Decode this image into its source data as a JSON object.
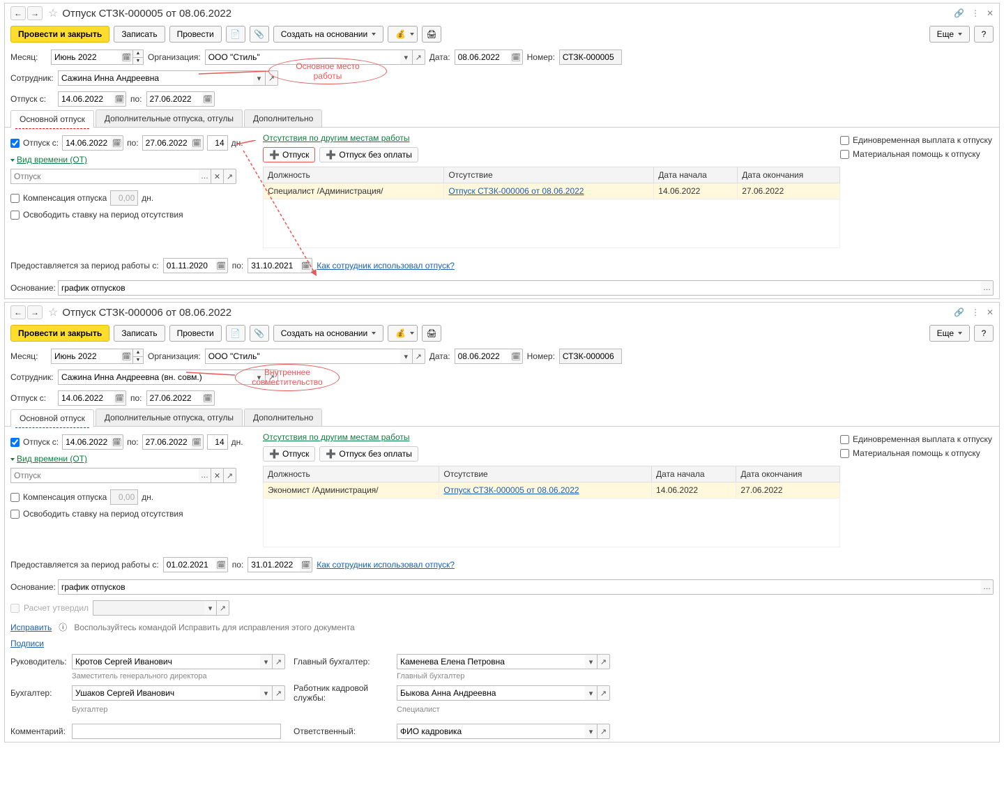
{
  "window1": {
    "title": "Отпуск СТЗК-000005 от 08.06.2022",
    "callout": "Основное место работы",
    "toolbar": {
      "post_close": "Провести и закрыть",
      "record": "Записать",
      "post": "Провести",
      "create_based": "Создать на основании",
      "more": "Еще"
    },
    "header": {
      "month_label": "Месяц:",
      "month": "Июнь 2022",
      "org_label": "Организация:",
      "org": "ООО \"Стиль\"",
      "date_label": "Дата:",
      "date": "08.06.2022",
      "num_label": "Номер:",
      "num": "СТЗК-000005",
      "employee_label": "Сотрудник:",
      "employee": "Сажина Инна Андреевна",
      "leave_from_label": "Отпуск с:",
      "leave_from": "14.06.2022",
      "leave_to_label": "по:",
      "leave_to": "27.06.2022"
    },
    "tabs": {
      "main": "Основной отпуск",
      "extra": "Дополнительные отпуска, отгулы",
      "more": "Дополнительно"
    },
    "mainTab": {
      "vac_label": "Отпуск  с:",
      "from": "14.06.2022",
      "to_label": "по:",
      "to": "27.06.2022",
      "days": "14",
      "days_unit": "дн.",
      "time_kind": "Вид времени (ОТ)",
      "time_placeholder": "Отпуск",
      "comp_label": "Компенсация отпуска",
      "comp_val": "0,00",
      "comp_unit": "дн.",
      "free_rate": "Освободить ставку на период отсутствия",
      "absences_link": "Отсутствия по другим местам работы",
      "btn_vac": "Отпуск",
      "btn_unpaid": "Отпуск без оплаты",
      "cols": {
        "pos": "Должность",
        "abs": "Отсутствие",
        "start": "Дата начала",
        "end": "Дата окончания"
      },
      "row": {
        "pos": "Специалист /Администрация/",
        "abs": "Отпуск СТЗК-000006 от 08.06.2022",
        "start": "14.06.2022",
        "end": "27.06.2022"
      },
      "lump_sum": "Единовременная выплата к отпуску",
      "mat_help": "Материальная помощь к отпуску"
    },
    "period": {
      "label": "Предоставляется за период работы с:",
      "from": "01.11.2020",
      "to_label": "по:",
      "to": "31.10.2021",
      "how_link": "Как сотрудник использовал отпуск?"
    },
    "basis": {
      "label": "Основание:",
      "value": "график отпусков"
    }
  },
  "window2": {
    "title": "Отпуск СТЗК-000006 от 08.06.2022",
    "callout": "Внутреннее совместительство",
    "toolbar": {
      "post_close": "Провести и закрыть",
      "record": "Записать",
      "post": "Провести",
      "create_based": "Создать на основании",
      "more": "Еще"
    },
    "header": {
      "month_label": "Месяц:",
      "month": "Июнь 2022",
      "org_label": "Организация:",
      "org": "ООО \"Стиль\"",
      "date_label": "Дата:",
      "date": "08.06.2022",
      "num_label": "Номер:",
      "num": "СТЗК-000006",
      "employee_label": "Сотрудник:",
      "employee": "Сажина Инна Андреевна (вн. совм.)",
      "leave_from_label": "Отпуск с:",
      "leave_from": "14.06.2022",
      "leave_to_label": "по:",
      "leave_to": "27.06.2022"
    },
    "tabs": {
      "main": "Основной отпуск",
      "extra": "Дополнительные отпуска, отгулы",
      "more": "Дополнительно"
    },
    "mainTab": {
      "vac_label": "Отпуск  с:",
      "from": "14.06.2022",
      "to_label": "по:",
      "to": "27.06.2022",
      "days": "14",
      "days_unit": "дн.",
      "time_kind": "Вид времени (ОТ)",
      "time_placeholder": "Отпуск",
      "comp_label": "Компенсация отпуска",
      "comp_val": "0,00",
      "comp_unit": "дн.",
      "free_rate": "Освободить ставку на период отсутствия",
      "absences_link": "Отсутствия по другим местам работы",
      "btn_vac": "Отпуск",
      "btn_unpaid": "Отпуск без оплаты",
      "cols": {
        "pos": "Должность",
        "abs": "Отсутствие",
        "start": "Дата начала",
        "end": "Дата окончания"
      },
      "row": {
        "pos": "Экономист /Администрация/",
        "abs": "Отпуск СТЗК-000005 от 08.06.2022",
        "start": "14.06.2022",
        "end": "27.06.2022"
      },
      "lump_sum": "Единовременная выплата к отпуску",
      "mat_help": "Материальная помощь к отпуску"
    },
    "period": {
      "label": "Предоставляется за период работы с:",
      "from": "01.02.2021",
      "to_label": "по:",
      "to": "31.01.2022",
      "how_link": "Как сотрудник использовал отпуск?"
    },
    "basis": {
      "label": "Основание:",
      "value": "график отпусков"
    },
    "calc_approved": "Расчет утвердил",
    "fix_link": "Исправить",
    "fix_hint": "Воспользуйтесь командой Исправить для исправления этого документа",
    "signatures_link": "Подписи",
    "sig": {
      "head_lbl": "Руководитель:",
      "head": "Кротов Сергей Иванович",
      "head_sub": "Заместитель генерального директора",
      "chief_acc_lbl": "Главный бухгалтер:",
      "chief_acc": "Каменева Елена Петровна",
      "chief_acc_sub": "Главный бухгалтер",
      "acc_lbl": "Бухгалтер:",
      "acc": "Ушаков Сергей Иванович",
      "acc_sub": "Бухгалтер",
      "hr_lbl": "Работник кадровой службы:",
      "hr": "Быкова Анна Андреевна",
      "hr_sub": "Специалист",
      "comment_lbl": "Комментарий:",
      "resp_lbl": "Ответственный:",
      "resp": "ФИО кадровика"
    }
  }
}
